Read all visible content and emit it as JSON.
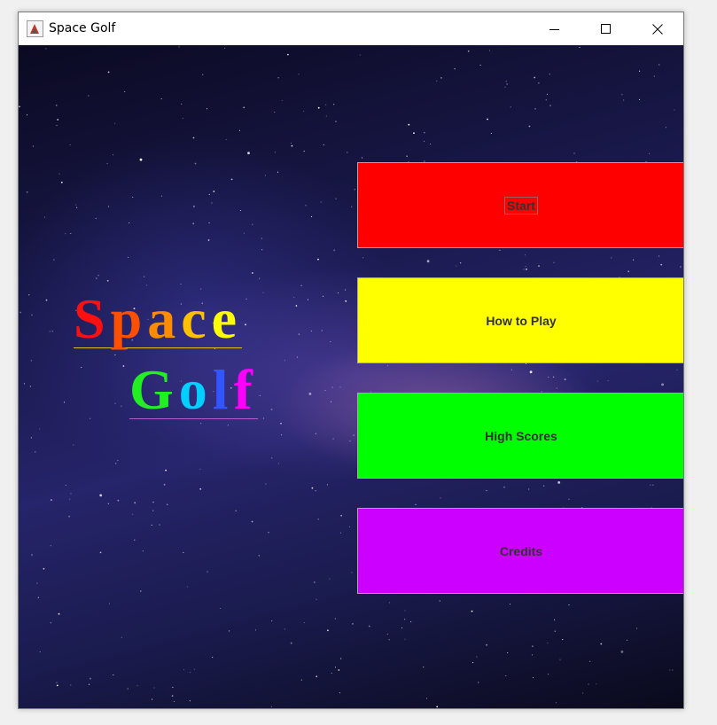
{
  "window": {
    "title": "Space Golf",
    "controls": [
      "minimize-icon",
      "maximize-icon",
      "close-icon"
    ]
  },
  "logo": {
    "line1": [
      "S",
      "p",
      "a",
      "c",
      "e"
    ],
    "line2": [
      "G",
      "o",
      "l",
      "f"
    ],
    "line1_colors": [
      "#ff1010",
      "#ff5000",
      "#ff8c00",
      "#ffc000",
      "#ffff00"
    ],
    "line2_colors": [
      "#22ee22",
      "#00d0ff",
      "#3355ff",
      "#ff00ff"
    ]
  },
  "menu": {
    "buttons": [
      {
        "label": "Start",
        "color": "#ff0000",
        "focused": true
      },
      {
        "label": "How to Play",
        "color": "#ffff00",
        "focused": false
      },
      {
        "label": "High Scores",
        "color": "#00ff00",
        "focused": false
      },
      {
        "label": "Credits",
        "color": "#cc00ff",
        "focused": false
      }
    ]
  }
}
